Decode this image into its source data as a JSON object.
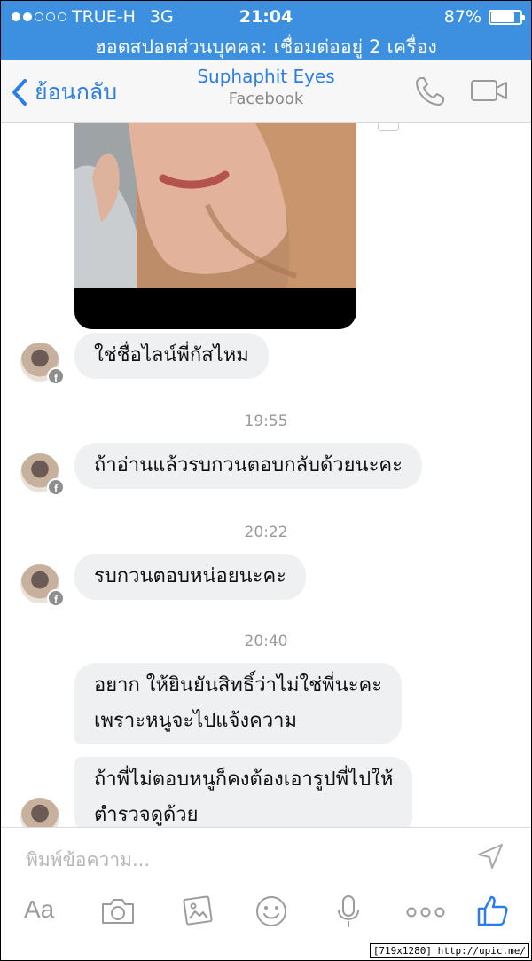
{
  "status_bar": {
    "carrier": "TRUE-H",
    "network": "3G",
    "time": "21:04",
    "battery_text": "87%",
    "battery_level": 0.87,
    "signal_bars_filled": 2,
    "signal_bars_total": 5
  },
  "hotspot_banner": "ฮอตสปอตส่วนบุคคล: เชื่อมต่ออยู่ 2 เครื่อง",
  "nav": {
    "back_label": "ย้อนกลับ",
    "title": "Suphaphit Eyes",
    "subtitle": "Facebook"
  },
  "messages": [
    {
      "text": "ใช่ชื่อไลน์พี่กัสไหม"
    },
    {
      "timestamp": "19:55",
      "text": "ถ้าอ่านแล้วรบกวนตอบกลับด้วยนะคะ"
    },
    {
      "timestamp": "20:22",
      "text": "รบกวนตอบหน่อยนะคะ"
    },
    {
      "timestamp": "20:40",
      "lines": [
        "อยาก ให้ยินยันสิทธิ์ว่าไม่ใช่พี่นะคะ",
        "เพราะหนูจะไปแจ้งความ"
      ]
    },
    {
      "lines": [
        "ถ้าพี่ไม่ตอบหนูก็คงต้องเอารูปพี่ไปให้",
        "ตำรวจดูด้วย"
      ]
    }
  ],
  "composer": {
    "placeholder": "พิมพ์ข้อความ...",
    "aa_label": "Aa",
    "icons": [
      "text-size-icon",
      "camera-icon",
      "photo-icon",
      "emoji-icon",
      "microphone-icon",
      "more-icon",
      "like-icon"
    ]
  },
  "colors": {
    "status_bar_bg": "#3d8fe0",
    "accent": "#2b7de9",
    "bubble_bg": "#eef0f2",
    "timestamp": "#9a9a9a"
  },
  "watermark": "[719x1280] http://upic.me/"
}
